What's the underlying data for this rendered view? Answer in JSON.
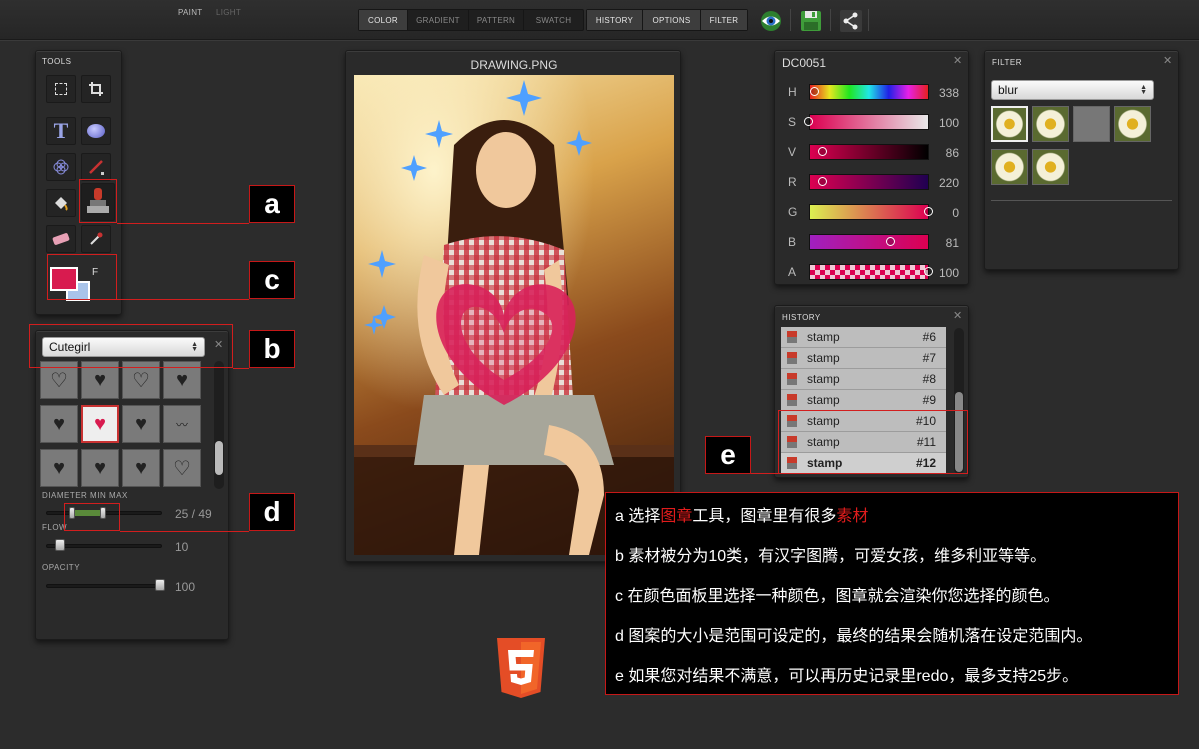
{
  "topbar": {
    "mode_paint": "PAINT",
    "mode_light": "LIGHT",
    "tabs_left": [
      {
        "label": "COLOR",
        "active": true
      },
      {
        "label": "GRADIENT",
        "active": false
      },
      {
        "label": "PATTERN",
        "active": false
      },
      {
        "label": "SWATCH",
        "active": false
      }
    ],
    "tabs_right": [
      {
        "label": "HISTORY",
        "active": true
      },
      {
        "label": "OPTIONS",
        "active": true
      },
      {
        "label": "FILTER",
        "active": true
      }
    ],
    "icons": [
      "eye-icon",
      "save-icon",
      "share-icon"
    ]
  },
  "tools": {
    "title": "TOOLS",
    "items": [
      "marquee-icon",
      "crop-icon",
      "text-icon",
      "ellipse-icon",
      "spirograph-icon",
      "brush-icon",
      "fill-icon",
      "stamp-icon",
      "eraser-icon",
      "eyedropper-icon"
    ],
    "fill_label": "F",
    "fill_color": "#d81b4f",
    "stroke_color": "#a9c4ea"
  },
  "stamp_panel": {
    "category": "Cutegirl",
    "close": "✕",
    "diameter_label": "DIAMETER MIN MAX",
    "diameter_value": "25 / 49",
    "flow_label": "FLOW",
    "flow_value": "10",
    "opacity_label": "OPACITY",
    "opacity_value": "100"
  },
  "canvas": {
    "title": "DRAWING.PNG"
  },
  "color_panel": {
    "title": "DC0051",
    "close": "✕",
    "channels": [
      {
        "label": "H",
        "value": "338",
        "level": 0.05
      },
      {
        "label": "S",
        "value": "100",
        "level": 0.0
      },
      {
        "label": "V",
        "value": "86",
        "level": 0.12
      },
      {
        "label": "R",
        "value": "220",
        "level": 0.12
      },
      {
        "label": "G",
        "value": "0",
        "level": 1.0
      },
      {
        "label": "B",
        "value": "81",
        "level": 0.68
      },
      {
        "label": "A",
        "value": "100",
        "level": 1.0
      }
    ]
  },
  "history_panel": {
    "title": "HISTORY",
    "close": "✕",
    "rows": [
      {
        "name": "stamp",
        "num": "#6"
      },
      {
        "name": "stamp",
        "num": "#7"
      },
      {
        "name": "stamp",
        "num": "#8"
      },
      {
        "name": "stamp",
        "num": "#9"
      },
      {
        "name": "stamp",
        "num": "#10"
      },
      {
        "name": "stamp",
        "num": "#11"
      },
      {
        "name": "stamp",
        "num": "#12"
      }
    ]
  },
  "filter_panel": {
    "title": "FILTER",
    "close": "✕",
    "selected": "blur"
  },
  "annotations": {
    "a": "a",
    "b": "b",
    "c": "c",
    "d": "d",
    "e": "e"
  },
  "notes": {
    "a_prefix": "a  选择",
    "a_red1": "图章",
    "a_mid": "工具，图章里有很多",
    "a_red2": "素材",
    "b": "b  素材被分为10类，有汉字图腾，可爱女孩，维多利亚等等。",
    "c": "c  在颜色面板里选择一种颜色，图章就会渲染你您选择的颜色。",
    "d": "d  图案的大小是范围可设定的，最终的结果会随机落在设定范围内。",
    "e": "e  如果您对结果不满意，可以再历史记录里redo，最多支持25步。"
  },
  "colors": {
    "accent_red": "#d21e1e",
    "fill": "#d81b4f",
    "html5": "#e44d26"
  }
}
